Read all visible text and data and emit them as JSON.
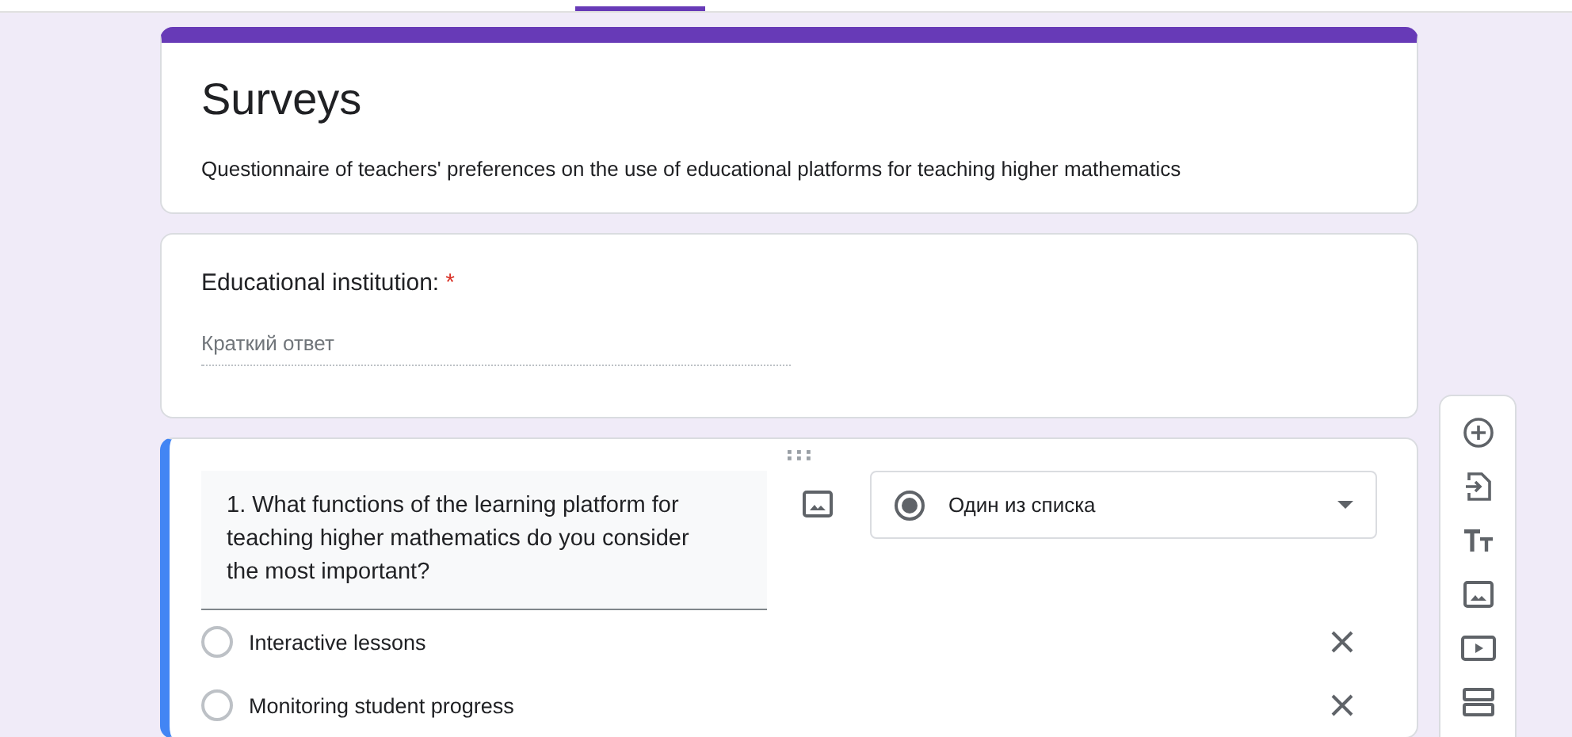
{
  "header": {
    "title": "Surveys",
    "description": "Questionnaire of teachers' preferences on the use of educational platforms for teaching higher mathematics"
  },
  "questions": [
    {
      "kind": "short_answer",
      "label": "Educational institution:",
      "required_mark": "*",
      "placeholder": "Краткий ответ"
    },
    {
      "kind": "choice_editor",
      "question": "1. What functions of the learning platform for teaching higher mathematics do you consider the most important?",
      "type_label": "Один из списка",
      "options": [
        "Interactive lessons",
        "Monitoring student progress"
      ]
    }
  ]
}
